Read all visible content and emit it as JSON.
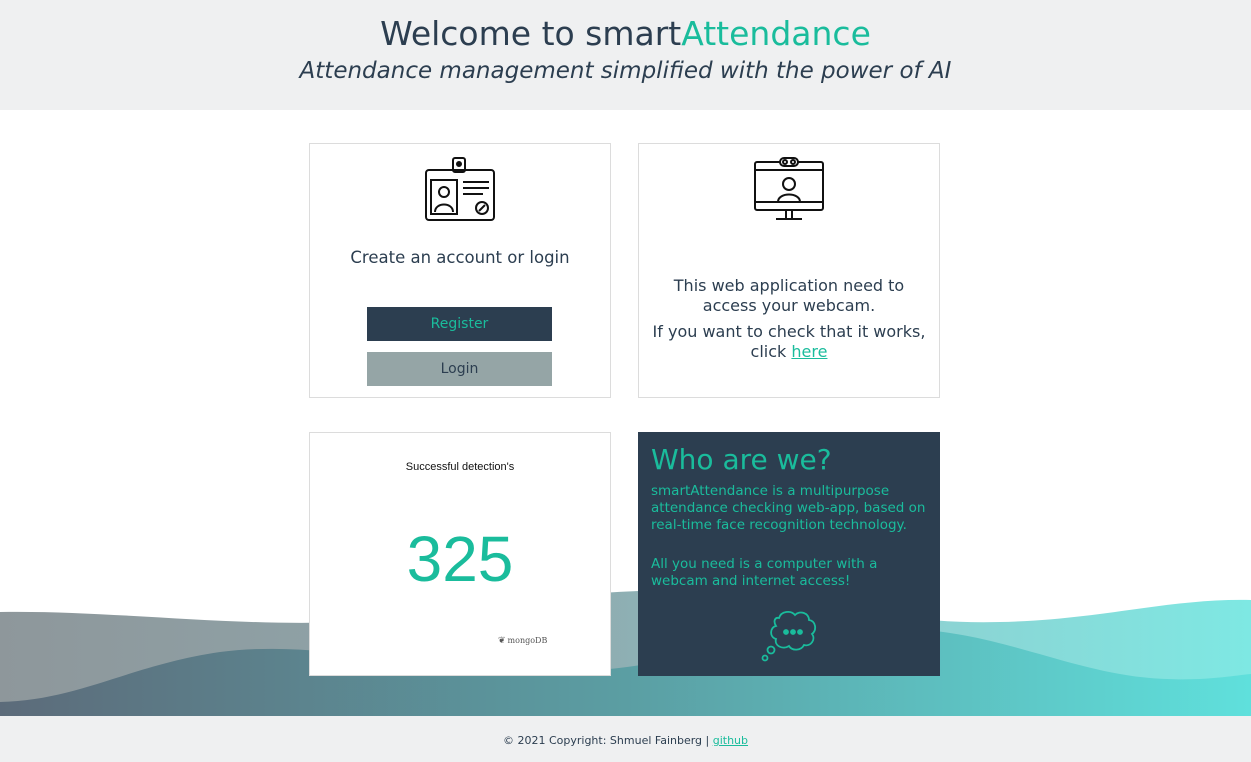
{
  "header": {
    "title_prefix": "Welcome to smart",
    "title_accent": "Attendance",
    "subtitle": "Attendance management simplified with the power of AI"
  },
  "account_card": {
    "icon": "id-badge-icon",
    "label": "Create an account or login",
    "register_label": "Register",
    "login_label": "Login"
  },
  "webcam_card": {
    "icon": "webcam-monitor-icon",
    "line1": "This web application need to access your webcam.",
    "line2_prefix": "If you want to check that it works, click",
    "link_label": "here"
  },
  "stats_card": {
    "title": "Successful detection's",
    "value": "325",
    "brand": "mongoDB"
  },
  "about_card": {
    "title": "Who are we?",
    "paragraph1": "smartAttendance is a multipurpose attendance checking web-app, based on real-time face recognition technology.",
    "paragraph2": "All you need is a computer with a webcam and internet access!",
    "icon": "thought-bubble-icon"
  },
  "footer": {
    "copyright": "© 2021 Copyright: Shmuel Fainberg |",
    "link_label": "github"
  },
  "colors": {
    "accent": "#1abc9c",
    "dark": "#2c3e50",
    "muted": "#95a5a6",
    "light_bg": "#eff0f1"
  }
}
